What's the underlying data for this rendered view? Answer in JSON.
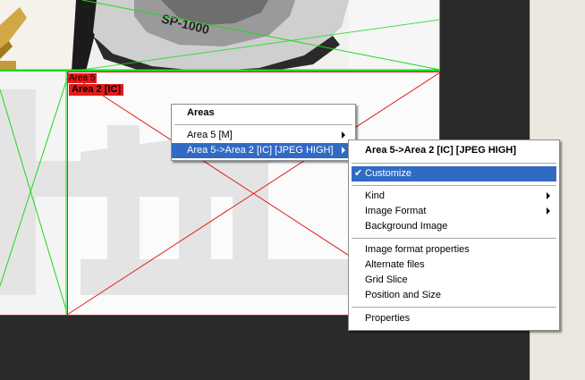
{
  "canvas": {
    "image_text": "SP-1000",
    "area_label_top": "Area 5",
    "area_label_tag": "Area 2 [IC]"
  },
  "menu_areas": {
    "header": "Areas",
    "items": [
      {
        "label": "Area 5 [M]",
        "has_submenu": true
      },
      {
        "label": "Area 5->Area 2 [IC] [JPEG HIGH]",
        "has_submenu": true,
        "selected": true
      }
    ]
  },
  "menu_sub": {
    "header": "Area 5->Area 2 [IC] [JPEG HIGH]",
    "customize": {
      "label": "Customize",
      "checked": true
    },
    "kind": "Kind",
    "image_format": "Image Format",
    "background_image": "Background Image",
    "image_format_properties": "Image format properties",
    "alternate_files": "Alternate files",
    "grid_slice": "Grid Slice",
    "position_and_size": "Position and Size",
    "properties": "Properties"
  },
  "colors": {
    "selection": "#316ac5",
    "area_border_red": "#e31b1b",
    "area_border_green": "#1ed81e"
  },
  "icons": [
    "checkmark-icon",
    "submenu-arrow-icon"
  ]
}
